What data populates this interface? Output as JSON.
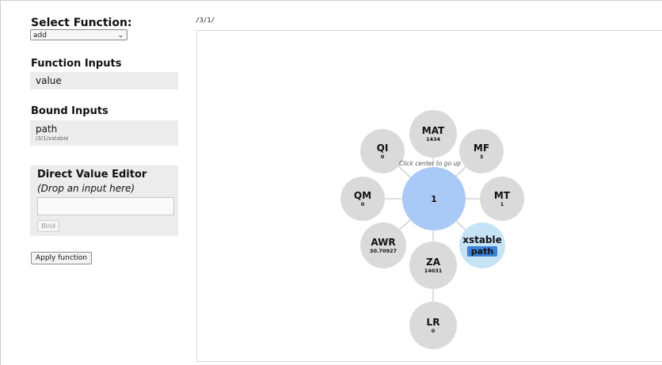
{
  "sidebar": {
    "select_function_heading": "Select Function:",
    "selected_function": "add",
    "function_inputs_heading": "Function Inputs",
    "function_inputs": [
      {
        "label": "value"
      }
    ],
    "bound_inputs_heading": "Bound Inputs",
    "bound_inputs": [
      {
        "label": "path",
        "value": "/3/1/xstable"
      }
    ],
    "direct_value_editor": {
      "title": "Direct Value Editor",
      "hint": "(Drop an input here)",
      "input_value": "",
      "bind_label": "Bind"
    },
    "apply_label": "Apply function"
  },
  "main": {
    "path": "/3/1/",
    "center_hint": "Click center to go up",
    "center_node": {
      "label": "1"
    },
    "nodes": [
      {
        "label": "MAT",
        "value": "1434"
      },
      {
        "label": "MF",
        "value": "3"
      },
      {
        "label": "MT",
        "value": "1"
      },
      {
        "label": "xstable",
        "tag": "path"
      },
      {
        "label": "ZA",
        "value": "14031"
      },
      {
        "label": "AWR",
        "value": "30.70927"
      },
      {
        "label": "QM",
        "value": "0"
      },
      {
        "label": "QI",
        "value": "0"
      },
      {
        "label": "LR",
        "value": "0"
      }
    ]
  },
  "colors": {
    "node_gray": "#dadada",
    "center_blue": "#a9c9f6",
    "bound_light_blue": "#c6e3f6",
    "tag_blue": "#3b82d4",
    "edge": "#bdbdbd"
  }
}
